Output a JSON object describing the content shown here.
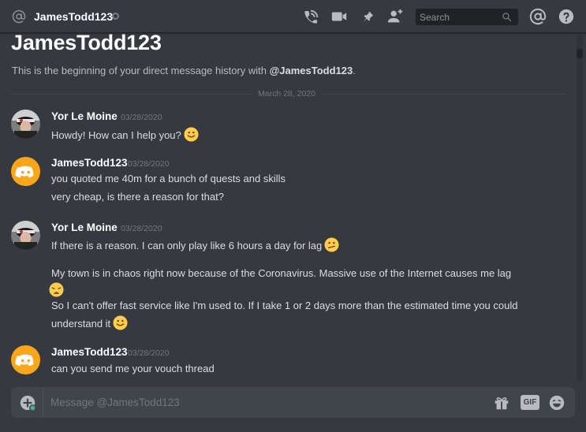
{
  "header": {
    "channel_name": "JamesTodd123",
    "search_placeholder": "Search"
  },
  "intro": {
    "title": "JamesTodd123",
    "text_before": "This is the beginning of your direct message history with ",
    "mention": "@JamesTodd123",
    "text_after": "."
  },
  "divider_date": "March 28, 2020",
  "messages": [
    {
      "author": "Yor Le Moine",
      "timestamp": "03/28/2020",
      "avatar": "user-photo",
      "lines": [
        "Howdy! How can I help you?"
      ]
    },
    {
      "author": "JamesTodd123",
      "timestamp": "03/28/2020",
      "avatar": "discord-logo",
      "lines": [
        "you quoted me 40m for a bunch of quests and skills",
        "very cheap, is there a reason for that?"
      ]
    },
    {
      "author": "Yor Le Moine",
      "timestamp": "03/28/2020",
      "avatar": "user-photo",
      "lines": [
        "If there is a reason. I can only play like 6 hours a day for lag",
        "My town is in chaos right now because of the Coronavirus. Massive use of the Internet causes me lag",
        "So I can't offer fast service like I'm used to. If I take 1 or 2 days more than the estimated time you could",
        "understand it"
      ]
    },
    {
      "author": "JamesTodd123",
      "timestamp": "03/28/2020",
      "avatar": "discord-logo",
      "lines": [
        "can you send me your vouch thread"
      ]
    }
  ],
  "composer": {
    "placeholder": "Message @JamesTodd123",
    "gif_label": "GIF"
  },
  "colors": {
    "background": "#36393f",
    "header_border": "#202225",
    "text": "#dcddde",
    "muted": "#72767d",
    "discord_orange": "#faa61a",
    "status_offline": "#747f8d"
  }
}
